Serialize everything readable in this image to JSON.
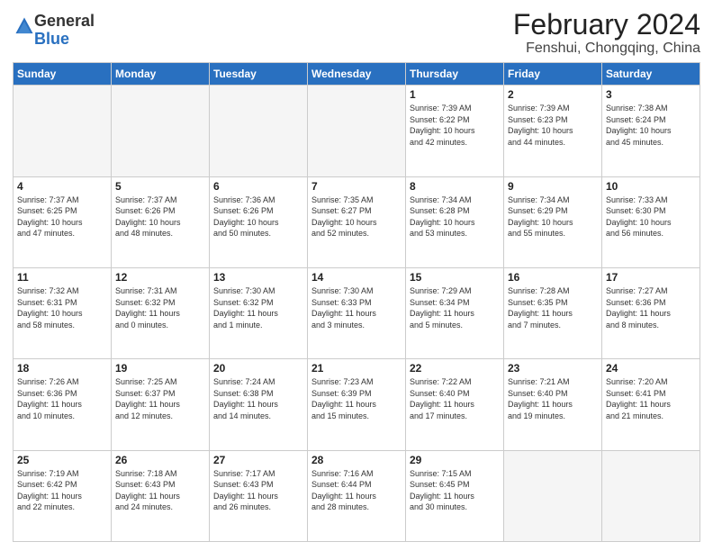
{
  "logo": {
    "general": "General",
    "blue": "Blue"
  },
  "title": "February 2024",
  "subtitle": "Fenshui, Chongqing, China",
  "headers": [
    "Sunday",
    "Monday",
    "Tuesday",
    "Wednesday",
    "Thursday",
    "Friday",
    "Saturday"
  ],
  "weeks": [
    [
      {
        "day": "",
        "info": ""
      },
      {
        "day": "",
        "info": ""
      },
      {
        "day": "",
        "info": ""
      },
      {
        "day": "",
        "info": ""
      },
      {
        "day": "1",
        "info": "Sunrise: 7:39 AM\nSunset: 6:22 PM\nDaylight: 10 hours\nand 42 minutes."
      },
      {
        "day": "2",
        "info": "Sunrise: 7:39 AM\nSunset: 6:23 PM\nDaylight: 10 hours\nand 44 minutes."
      },
      {
        "day": "3",
        "info": "Sunrise: 7:38 AM\nSunset: 6:24 PM\nDaylight: 10 hours\nand 45 minutes."
      }
    ],
    [
      {
        "day": "4",
        "info": "Sunrise: 7:37 AM\nSunset: 6:25 PM\nDaylight: 10 hours\nand 47 minutes."
      },
      {
        "day": "5",
        "info": "Sunrise: 7:37 AM\nSunset: 6:26 PM\nDaylight: 10 hours\nand 48 minutes."
      },
      {
        "day": "6",
        "info": "Sunrise: 7:36 AM\nSunset: 6:26 PM\nDaylight: 10 hours\nand 50 minutes."
      },
      {
        "day": "7",
        "info": "Sunrise: 7:35 AM\nSunset: 6:27 PM\nDaylight: 10 hours\nand 52 minutes."
      },
      {
        "day": "8",
        "info": "Sunrise: 7:34 AM\nSunset: 6:28 PM\nDaylight: 10 hours\nand 53 minutes."
      },
      {
        "day": "9",
        "info": "Sunrise: 7:34 AM\nSunset: 6:29 PM\nDaylight: 10 hours\nand 55 minutes."
      },
      {
        "day": "10",
        "info": "Sunrise: 7:33 AM\nSunset: 6:30 PM\nDaylight: 10 hours\nand 56 minutes."
      }
    ],
    [
      {
        "day": "11",
        "info": "Sunrise: 7:32 AM\nSunset: 6:31 PM\nDaylight: 10 hours\nand 58 minutes."
      },
      {
        "day": "12",
        "info": "Sunrise: 7:31 AM\nSunset: 6:32 PM\nDaylight: 11 hours\nand 0 minutes."
      },
      {
        "day": "13",
        "info": "Sunrise: 7:30 AM\nSunset: 6:32 PM\nDaylight: 11 hours\nand 1 minute."
      },
      {
        "day": "14",
        "info": "Sunrise: 7:30 AM\nSunset: 6:33 PM\nDaylight: 11 hours\nand 3 minutes."
      },
      {
        "day": "15",
        "info": "Sunrise: 7:29 AM\nSunset: 6:34 PM\nDaylight: 11 hours\nand 5 minutes."
      },
      {
        "day": "16",
        "info": "Sunrise: 7:28 AM\nSunset: 6:35 PM\nDaylight: 11 hours\nand 7 minutes."
      },
      {
        "day": "17",
        "info": "Sunrise: 7:27 AM\nSunset: 6:36 PM\nDaylight: 11 hours\nand 8 minutes."
      }
    ],
    [
      {
        "day": "18",
        "info": "Sunrise: 7:26 AM\nSunset: 6:36 PM\nDaylight: 11 hours\nand 10 minutes."
      },
      {
        "day": "19",
        "info": "Sunrise: 7:25 AM\nSunset: 6:37 PM\nDaylight: 11 hours\nand 12 minutes."
      },
      {
        "day": "20",
        "info": "Sunrise: 7:24 AM\nSunset: 6:38 PM\nDaylight: 11 hours\nand 14 minutes."
      },
      {
        "day": "21",
        "info": "Sunrise: 7:23 AM\nSunset: 6:39 PM\nDaylight: 11 hours\nand 15 minutes."
      },
      {
        "day": "22",
        "info": "Sunrise: 7:22 AM\nSunset: 6:40 PM\nDaylight: 11 hours\nand 17 minutes."
      },
      {
        "day": "23",
        "info": "Sunrise: 7:21 AM\nSunset: 6:40 PM\nDaylight: 11 hours\nand 19 minutes."
      },
      {
        "day": "24",
        "info": "Sunrise: 7:20 AM\nSunset: 6:41 PM\nDaylight: 11 hours\nand 21 minutes."
      }
    ],
    [
      {
        "day": "25",
        "info": "Sunrise: 7:19 AM\nSunset: 6:42 PM\nDaylight: 11 hours\nand 22 minutes."
      },
      {
        "day": "26",
        "info": "Sunrise: 7:18 AM\nSunset: 6:43 PM\nDaylight: 11 hours\nand 24 minutes."
      },
      {
        "day": "27",
        "info": "Sunrise: 7:17 AM\nSunset: 6:43 PM\nDaylight: 11 hours\nand 26 minutes."
      },
      {
        "day": "28",
        "info": "Sunrise: 7:16 AM\nSunset: 6:44 PM\nDaylight: 11 hours\nand 28 minutes."
      },
      {
        "day": "29",
        "info": "Sunrise: 7:15 AM\nSunset: 6:45 PM\nDaylight: 11 hours\nand 30 minutes."
      },
      {
        "day": "",
        "info": ""
      },
      {
        "day": "",
        "info": ""
      }
    ]
  ]
}
